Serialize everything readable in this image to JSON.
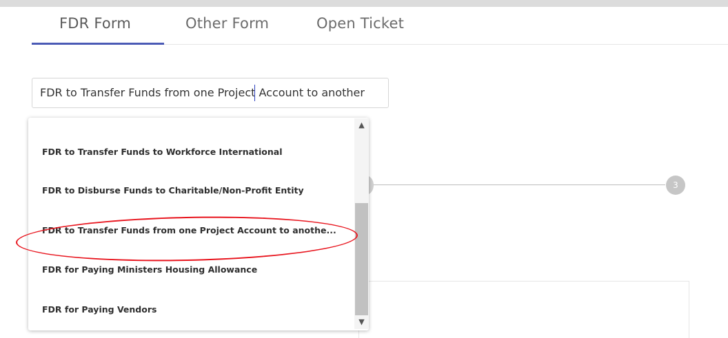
{
  "tabs": [
    {
      "label": "FDR Form"
    },
    {
      "label": "Other Form"
    },
    {
      "label": "Open Ticket"
    }
  ],
  "form_select": {
    "value": "FDR to Transfer Funds from one Project Account to another"
  },
  "dropdown": {
    "options": [
      {
        "label": "FDR to Transfer Funds to Workforce International"
      },
      {
        "label": "FDR to Disburse Funds to Charitable/Non-Profit Entity"
      },
      {
        "label": "FDR to Transfer Funds from one Project Account to anothe..."
      },
      {
        "label": "FDR for Paying Ministers Housing Allowance"
      },
      {
        "label": "FDR for Paying Vendors"
      }
    ],
    "scroll_up_icon": "▲",
    "scroll_down_icon": "▼"
  },
  "stepper": {
    "step3_label": "3"
  },
  "colors": {
    "accent": "#4a5ab5",
    "annotation": "#e8141d"
  }
}
